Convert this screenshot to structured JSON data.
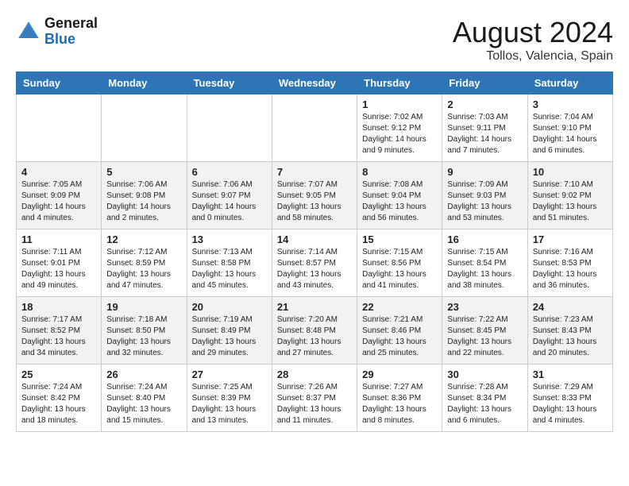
{
  "header": {
    "logo_general": "General",
    "logo_blue": "Blue",
    "month_year": "August 2024",
    "location": "Tollos, Valencia, Spain"
  },
  "days_of_week": [
    "Sunday",
    "Monday",
    "Tuesday",
    "Wednesday",
    "Thursday",
    "Friday",
    "Saturday"
  ],
  "weeks": [
    [
      {
        "day": "",
        "info": ""
      },
      {
        "day": "",
        "info": ""
      },
      {
        "day": "",
        "info": ""
      },
      {
        "day": "",
        "info": ""
      },
      {
        "day": "1",
        "info": "Sunrise: 7:02 AM\nSunset: 9:12 PM\nDaylight: 14 hours\nand 9 minutes."
      },
      {
        "day": "2",
        "info": "Sunrise: 7:03 AM\nSunset: 9:11 PM\nDaylight: 14 hours\nand 7 minutes."
      },
      {
        "day": "3",
        "info": "Sunrise: 7:04 AM\nSunset: 9:10 PM\nDaylight: 14 hours\nand 6 minutes."
      }
    ],
    [
      {
        "day": "4",
        "info": "Sunrise: 7:05 AM\nSunset: 9:09 PM\nDaylight: 14 hours\nand 4 minutes."
      },
      {
        "day": "5",
        "info": "Sunrise: 7:06 AM\nSunset: 9:08 PM\nDaylight: 14 hours\nand 2 minutes."
      },
      {
        "day": "6",
        "info": "Sunrise: 7:06 AM\nSunset: 9:07 PM\nDaylight: 14 hours\nand 0 minutes."
      },
      {
        "day": "7",
        "info": "Sunrise: 7:07 AM\nSunset: 9:05 PM\nDaylight: 13 hours\nand 58 minutes."
      },
      {
        "day": "8",
        "info": "Sunrise: 7:08 AM\nSunset: 9:04 PM\nDaylight: 13 hours\nand 56 minutes."
      },
      {
        "day": "9",
        "info": "Sunrise: 7:09 AM\nSunset: 9:03 PM\nDaylight: 13 hours\nand 53 minutes."
      },
      {
        "day": "10",
        "info": "Sunrise: 7:10 AM\nSunset: 9:02 PM\nDaylight: 13 hours\nand 51 minutes."
      }
    ],
    [
      {
        "day": "11",
        "info": "Sunrise: 7:11 AM\nSunset: 9:01 PM\nDaylight: 13 hours\nand 49 minutes."
      },
      {
        "day": "12",
        "info": "Sunrise: 7:12 AM\nSunset: 8:59 PM\nDaylight: 13 hours\nand 47 minutes."
      },
      {
        "day": "13",
        "info": "Sunrise: 7:13 AM\nSunset: 8:58 PM\nDaylight: 13 hours\nand 45 minutes."
      },
      {
        "day": "14",
        "info": "Sunrise: 7:14 AM\nSunset: 8:57 PM\nDaylight: 13 hours\nand 43 minutes."
      },
      {
        "day": "15",
        "info": "Sunrise: 7:15 AM\nSunset: 8:56 PM\nDaylight: 13 hours\nand 41 minutes."
      },
      {
        "day": "16",
        "info": "Sunrise: 7:15 AM\nSunset: 8:54 PM\nDaylight: 13 hours\nand 38 minutes."
      },
      {
        "day": "17",
        "info": "Sunrise: 7:16 AM\nSunset: 8:53 PM\nDaylight: 13 hours\nand 36 minutes."
      }
    ],
    [
      {
        "day": "18",
        "info": "Sunrise: 7:17 AM\nSunset: 8:52 PM\nDaylight: 13 hours\nand 34 minutes."
      },
      {
        "day": "19",
        "info": "Sunrise: 7:18 AM\nSunset: 8:50 PM\nDaylight: 13 hours\nand 32 minutes."
      },
      {
        "day": "20",
        "info": "Sunrise: 7:19 AM\nSunset: 8:49 PM\nDaylight: 13 hours\nand 29 minutes."
      },
      {
        "day": "21",
        "info": "Sunrise: 7:20 AM\nSunset: 8:48 PM\nDaylight: 13 hours\nand 27 minutes."
      },
      {
        "day": "22",
        "info": "Sunrise: 7:21 AM\nSunset: 8:46 PM\nDaylight: 13 hours\nand 25 minutes."
      },
      {
        "day": "23",
        "info": "Sunrise: 7:22 AM\nSunset: 8:45 PM\nDaylight: 13 hours\nand 22 minutes."
      },
      {
        "day": "24",
        "info": "Sunrise: 7:23 AM\nSunset: 8:43 PM\nDaylight: 13 hours\nand 20 minutes."
      }
    ],
    [
      {
        "day": "25",
        "info": "Sunrise: 7:24 AM\nSunset: 8:42 PM\nDaylight: 13 hours\nand 18 minutes."
      },
      {
        "day": "26",
        "info": "Sunrise: 7:24 AM\nSunset: 8:40 PM\nDaylight: 13 hours\nand 15 minutes."
      },
      {
        "day": "27",
        "info": "Sunrise: 7:25 AM\nSunset: 8:39 PM\nDaylight: 13 hours\nand 13 minutes."
      },
      {
        "day": "28",
        "info": "Sunrise: 7:26 AM\nSunset: 8:37 PM\nDaylight: 13 hours\nand 11 minutes."
      },
      {
        "day": "29",
        "info": "Sunrise: 7:27 AM\nSunset: 8:36 PM\nDaylight: 13 hours\nand 8 minutes."
      },
      {
        "day": "30",
        "info": "Sunrise: 7:28 AM\nSunset: 8:34 PM\nDaylight: 13 hours\nand 6 minutes."
      },
      {
        "day": "31",
        "info": "Sunrise: 7:29 AM\nSunset: 8:33 PM\nDaylight: 13 hours\nand 4 minutes."
      }
    ]
  ]
}
